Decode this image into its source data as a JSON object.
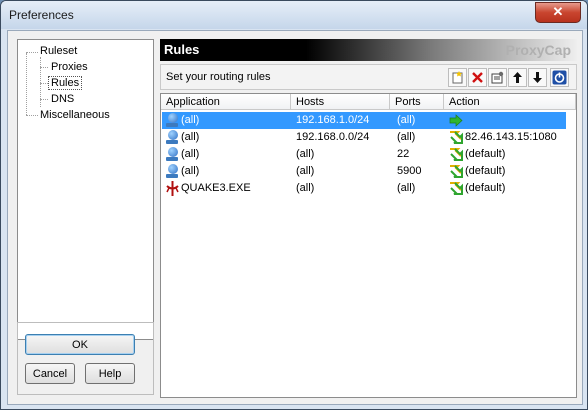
{
  "window": {
    "title": "Preferences",
    "close_glyph": "✕"
  },
  "tree": {
    "items": [
      {
        "label": "Ruleset",
        "level": 0
      },
      {
        "label": "Proxies",
        "level": 1
      },
      {
        "label": "Rules",
        "level": 1,
        "selected": true
      },
      {
        "label": "DNS",
        "level": 1
      },
      {
        "label": "Miscellaneous",
        "level": 0
      }
    ]
  },
  "buttons": {
    "ok": "OK",
    "cancel": "Cancel",
    "help": "Help"
  },
  "panel": {
    "title": "Rules",
    "brand": "ProxyCap",
    "toolbar_label": "Set your routing rules",
    "toolbar_icons": [
      "new-rule-icon",
      "delete-icon",
      "properties-icon",
      "move-up-icon",
      "move-down-icon",
      "power-icon"
    ]
  },
  "table": {
    "columns": [
      "Application",
      "Hosts",
      "Ports",
      "Action"
    ],
    "rows": [
      {
        "app": "(all)",
        "hosts": "192.168.1.0/24",
        "ports": "(all)",
        "action": "",
        "icon": "globe-icon",
        "action_icon": "direct-arrow-icon",
        "selected": true
      },
      {
        "app": "(all)",
        "hosts": "192.168.0.0/24",
        "ports": "(all)",
        "action": "82.46.143.15:1080",
        "icon": "globe-icon",
        "action_icon": "proxy-arrows-icon"
      },
      {
        "app": "(all)",
        "hosts": "(all)",
        "ports": "22",
        "action": "(default)",
        "icon": "globe-icon",
        "action_icon": "proxy-arrows-icon"
      },
      {
        "app": "(all)",
        "hosts": "(all)",
        "ports": "5900",
        "action": "(default)",
        "icon": "globe-icon",
        "action_icon": "proxy-arrows-icon"
      },
      {
        "app": "QUAKE3.EXE",
        "hosts": "(all)",
        "ports": "(all)",
        "action": "(default)",
        "icon": "quake-icon",
        "action_icon": "proxy-arrows-icon"
      }
    ]
  },
  "colors": {
    "selection": "#3399ff",
    "header_text": "#ffffff",
    "brand_text": "#b0b0b0"
  }
}
